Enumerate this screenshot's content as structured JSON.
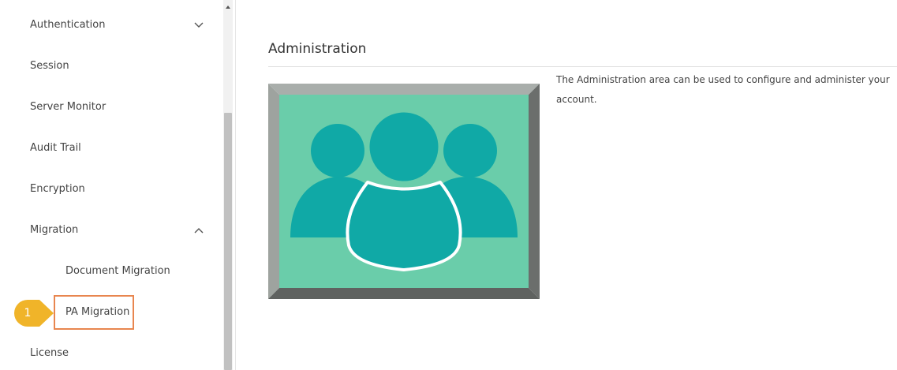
{
  "sidebar": {
    "items": [
      {
        "label": "Authentication"
      },
      {
        "label": "Session"
      },
      {
        "label": "Server Monitor"
      },
      {
        "label": "Audit Trail"
      },
      {
        "label": "Encryption"
      },
      {
        "label": "Migration"
      },
      {
        "label": "License"
      }
    ],
    "sub_items": [
      {
        "label": "Document Migration"
      },
      {
        "label": "PA Migration"
      }
    ],
    "icons": {
      "authentication_toggle": "chevron-down-icon",
      "migration_toggle": "chevron-up-icon"
    }
  },
  "callout": {
    "number": "1",
    "color": "#f0b429"
  },
  "highlight": {
    "color": "#e8864f"
  },
  "main": {
    "title": "Administration",
    "description": "The Administration area can be used to configure and administer your account.",
    "hero_icon": "users-group-icon",
    "hero_colors": {
      "background": "#6acdaa",
      "figure": "#10a9a6",
      "frame": "#9ea39f"
    }
  }
}
